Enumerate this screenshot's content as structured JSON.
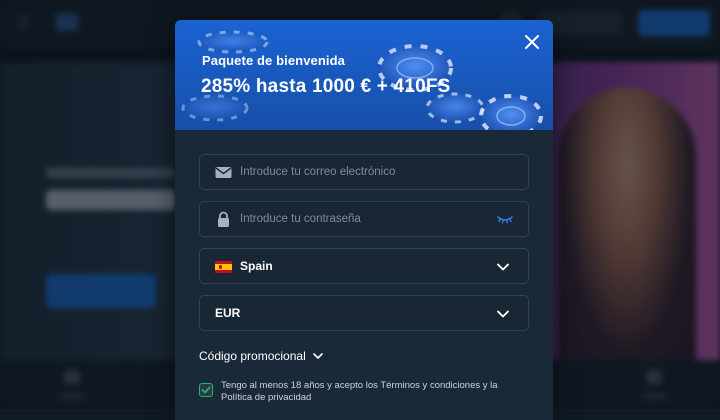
{
  "modal": {
    "subtitle": "Paquete de bienvenida",
    "title": "285% hasta 1000 € + 410FS"
  },
  "form": {
    "email": {
      "placeholder": "Introduce tu correo electrónico",
      "value": ""
    },
    "password": {
      "placeholder": "Introduce tu contraseña",
      "value": ""
    },
    "country": {
      "value": "Spain"
    },
    "currency": {
      "value": "EUR"
    },
    "promo_code": {
      "label": "Código promocional"
    },
    "consent": {
      "text": "Tengo al menos 18 años y acepto los Términos y condiciones y la Política de privacidad",
      "checked": true
    }
  },
  "colors": {
    "header_blue": "#1b63d2",
    "modal_bg": "#1a2937",
    "field_border": "#32414f",
    "check_green": "#26b36b",
    "eye_blue": "#2f7fe6"
  },
  "icons": {
    "close": "close-icon",
    "email": "envelope-icon",
    "password": "lock-icon",
    "show_password": "eye-closed-icon",
    "country": "spain-flag-icon",
    "dropdown": "chevron-down-icon",
    "check": "checkmark-icon"
  }
}
